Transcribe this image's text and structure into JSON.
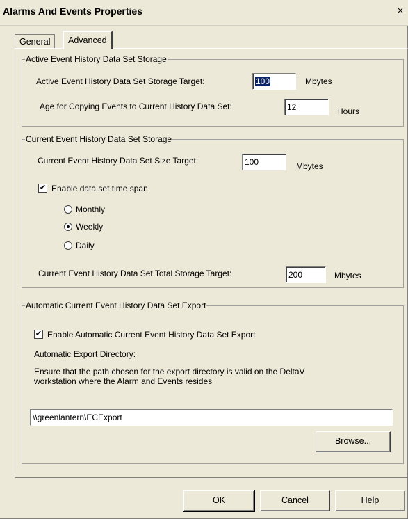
{
  "window": {
    "title": "Alarms And Events Properties",
    "close_glyph": "×"
  },
  "tabs": [
    {
      "label": "General",
      "active": false
    },
    {
      "label": "Advanced",
      "active": true
    }
  ],
  "active_history": {
    "legend": "Active Event History Data Set Storage",
    "storage_target_label": "Active Event History Data Set Storage Target:",
    "storage_target_value": "100",
    "storage_target_unit": "Mbytes",
    "age_label": "Age for Copying Events to Current History Data Set:",
    "age_value": "12",
    "age_unit": "Hours"
  },
  "current_history": {
    "legend": "Current Event History Data Set Storage",
    "size_target_label": "Current Event History Data Set Size Target:",
    "size_target_value": "100",
    "size_target_unit": "Mbytes",
    "enable_time_span_label": "Enable data set time span",
    "enable_time_span_checked": true,
    "radios": [
      {
        "label": "Monthly",
        "selected": false
      },
      {
        "label": "Weekly",
        "selected": true
      },
      {
        "label": "Daily",
        "selected": false
      }
    ],
    "total_target_label": "Current Event History Data Set Total Storage Target:",
    "total_target_value": "200",
    "total_target_unit": "Mbytes"
  },
  "export": {
    "legend": "Automatic Current Event History Data Set Export",
    "enable_label": "Enable Automatic Current Event History Data Set Export",
    "enable_checked": true,
    "directory_label": "Automatic Export Directory:",
    "note_line1": "Ensure that the path chosen for the export directory is valid on the DeltaV",
    "note_line2": "workstation where the Alarm and Events resides",
    "directory_value": "\\\\greenlantern\\ECExport",
    "browse_label": "Browse..."
  },
  "buttons": {
    "ok": "OK",
    "cancel": "Cancel",
    "help": "Help"
  },
  "colors": {
    "dialog_bg": "#ece9d8",
    "selection_bg": "#0a246a"
  },
  "icons": {
    "checkbox_checked": "✔"
  }
}
